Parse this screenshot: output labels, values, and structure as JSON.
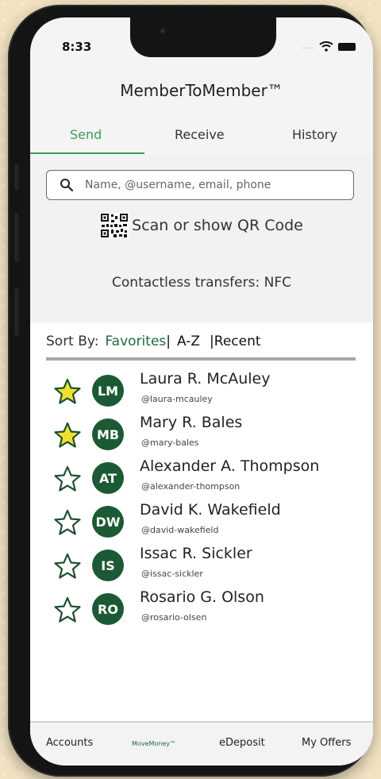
{
  "status_bar": {
    "time": "8:33",
    "signal": "....",
    "wifi_icon": "wifi-icon",
    "battery_icon": "battery-icon"
  },
  "app": {
    "title": "MemberToMember™"
  },
  "tabs": [
    {
      "label": "Send",
      "active": true
    },
    {
      "label": "Receive",
      "active": false
    },
    {
      "label": "History",
      "active": false
    }
  ],
  "search": {
    "placeholder": "Name, @username, email, phone",
    "icon": "search-icon"
  },
  "qr": {
    "label": "Scan or show QR Code",
    "icon": "qr-code-icon"
  },
  "nfc": {
    "label": "Contactless transfers: NFC"
  },
  "sort": {
    "prefix": "Sort By:",
    "options": [
      "Favorites",
      "A-Z",
      "Recent"
    ],
    "separators": [
      "|",
      "|"
    ],
    "active": "Favorites"
  },
  "colors": {
    "accent": "#3d9b5a",
    "avatar": "#1b5a34",
    "favorite_star": "#f0e030"
  },
  "contacts": [
    {
      "initials": "LM",
      "name": "Laura R. McAuley",
      "handle": "@laura-mcauley",
      "favorite": true
    },
    {
      "initials": "MB",
      "name": "Mary R. Bales",
      "handle": "@mary-bales",
      "favorite": true
    },
    {
      "initials": "AT",
      "name": "Alexander A. Thompson",
      "handle": "@alexander-thompson",
      "favorite": false
    },
    {
      "initials": "DW",
      "name": "David K. Wakefield",
      "handle": "@david-wakefield",
      "favorite": false
    },
    {
      "initials": "IS",
      "name": "Issac R. Sickler",
      "handle": "@issac-sickler",
      "favorite": false
    },
    {
      "initials": "RO",
      "name": "Rosario G. Olson",
      "handle": "@rosario-olsen",
      "favorite": false
    }
  ],
  "bottom_nav": [
    {
      "label": "Accounts"
    },
    {
      "label": "MoveMoney™"
    },
    {
      "label": "eDeposit"
    },
    {
      "label": "My Offers"
    }
  ]
}
